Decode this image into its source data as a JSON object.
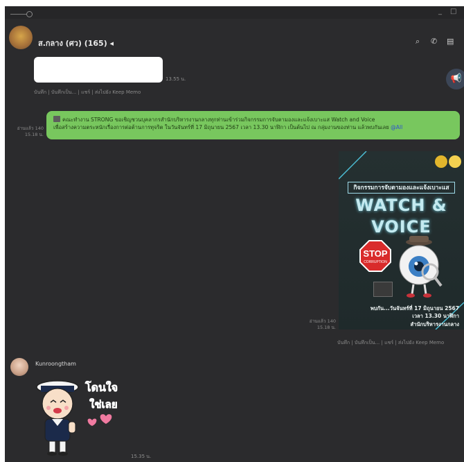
{
  "window": {
    "minimize_glyph": "_",
    "maximize_glyph": "□"
  },
  "header": {
    "title": "ส.กลาง (ศว) (165) ◂",
    "icons": [
      "search-icon",
      "phone-icon",
      "notes-icon"
    ],
    "search_glyph": "⌕",
    "phone_glyph": "✆",
    "notes_glyph": "▤"
  },
  "announcement_glyph": "📢",
  "messages": {
    "first": {
      "time": "13.55 น.",
      "actions": "บันทึก | บันทึกเป็น... | แชร์ | ส่งไปยัง Keep Memo"
    },
    "announcement": {
      "read": "อ่านแล้ว 140",
      "time": "15.18 น.",
      "line1": "คณะทำงาน STRONG ขอเชิญชวนบุคลากรสำนักบริหารงานกลางทุกท่านเข้าร่วมกิจกรรมการจับตามองและแจ้งเบาะแส Watch and Voice",
      "line2": "เพื่อสร้างความตระหนักเรื่องการต่อต้านการทุจริต ในวันจันทร์ที่ 17 มิถุนายน 2567 เวลา 13.30 นาฬิกา เป็นต้นไป ณ กลุ่มงานของท่าน แล้วพบกันเลย",
      "mention": "@All"
    },
    "poster": {
      "read": "อ่านแล้ว 140",
      "time": "15.18 น.",
      "heading": "กิจกรรมการจับตามองและแจ้งเบาะแส",
      "title1": "WATCH &",
      "title2": "VOICE",
      "stop": "STOP",
      "stop_sub": "CORRUPTION",
      "footer1": "พบกัน...วันจันทร์ที่ 17 มิถุนายน 2567",
      "footer2": "เวลา 13.30 นาฬิกา",
      "footer3": "สำนักบริหารงานกลาง",
      "actions": "บันทึก | บันทึกเป็น... | แชร์ | ส่งไปยัง Keep Memo"
    },
    "sticker": {
      "sender": "Kunroongtham",
      "text1": "โดนใจ",
      "text2": "ใช่เลย",
      "time": "15.35 น."
    }
  },
  "colors": {
    "background": "#2b2b2d",
    "bubble_green": "#78c75e",
    "mention": "#2c4fd2"
  }
}
